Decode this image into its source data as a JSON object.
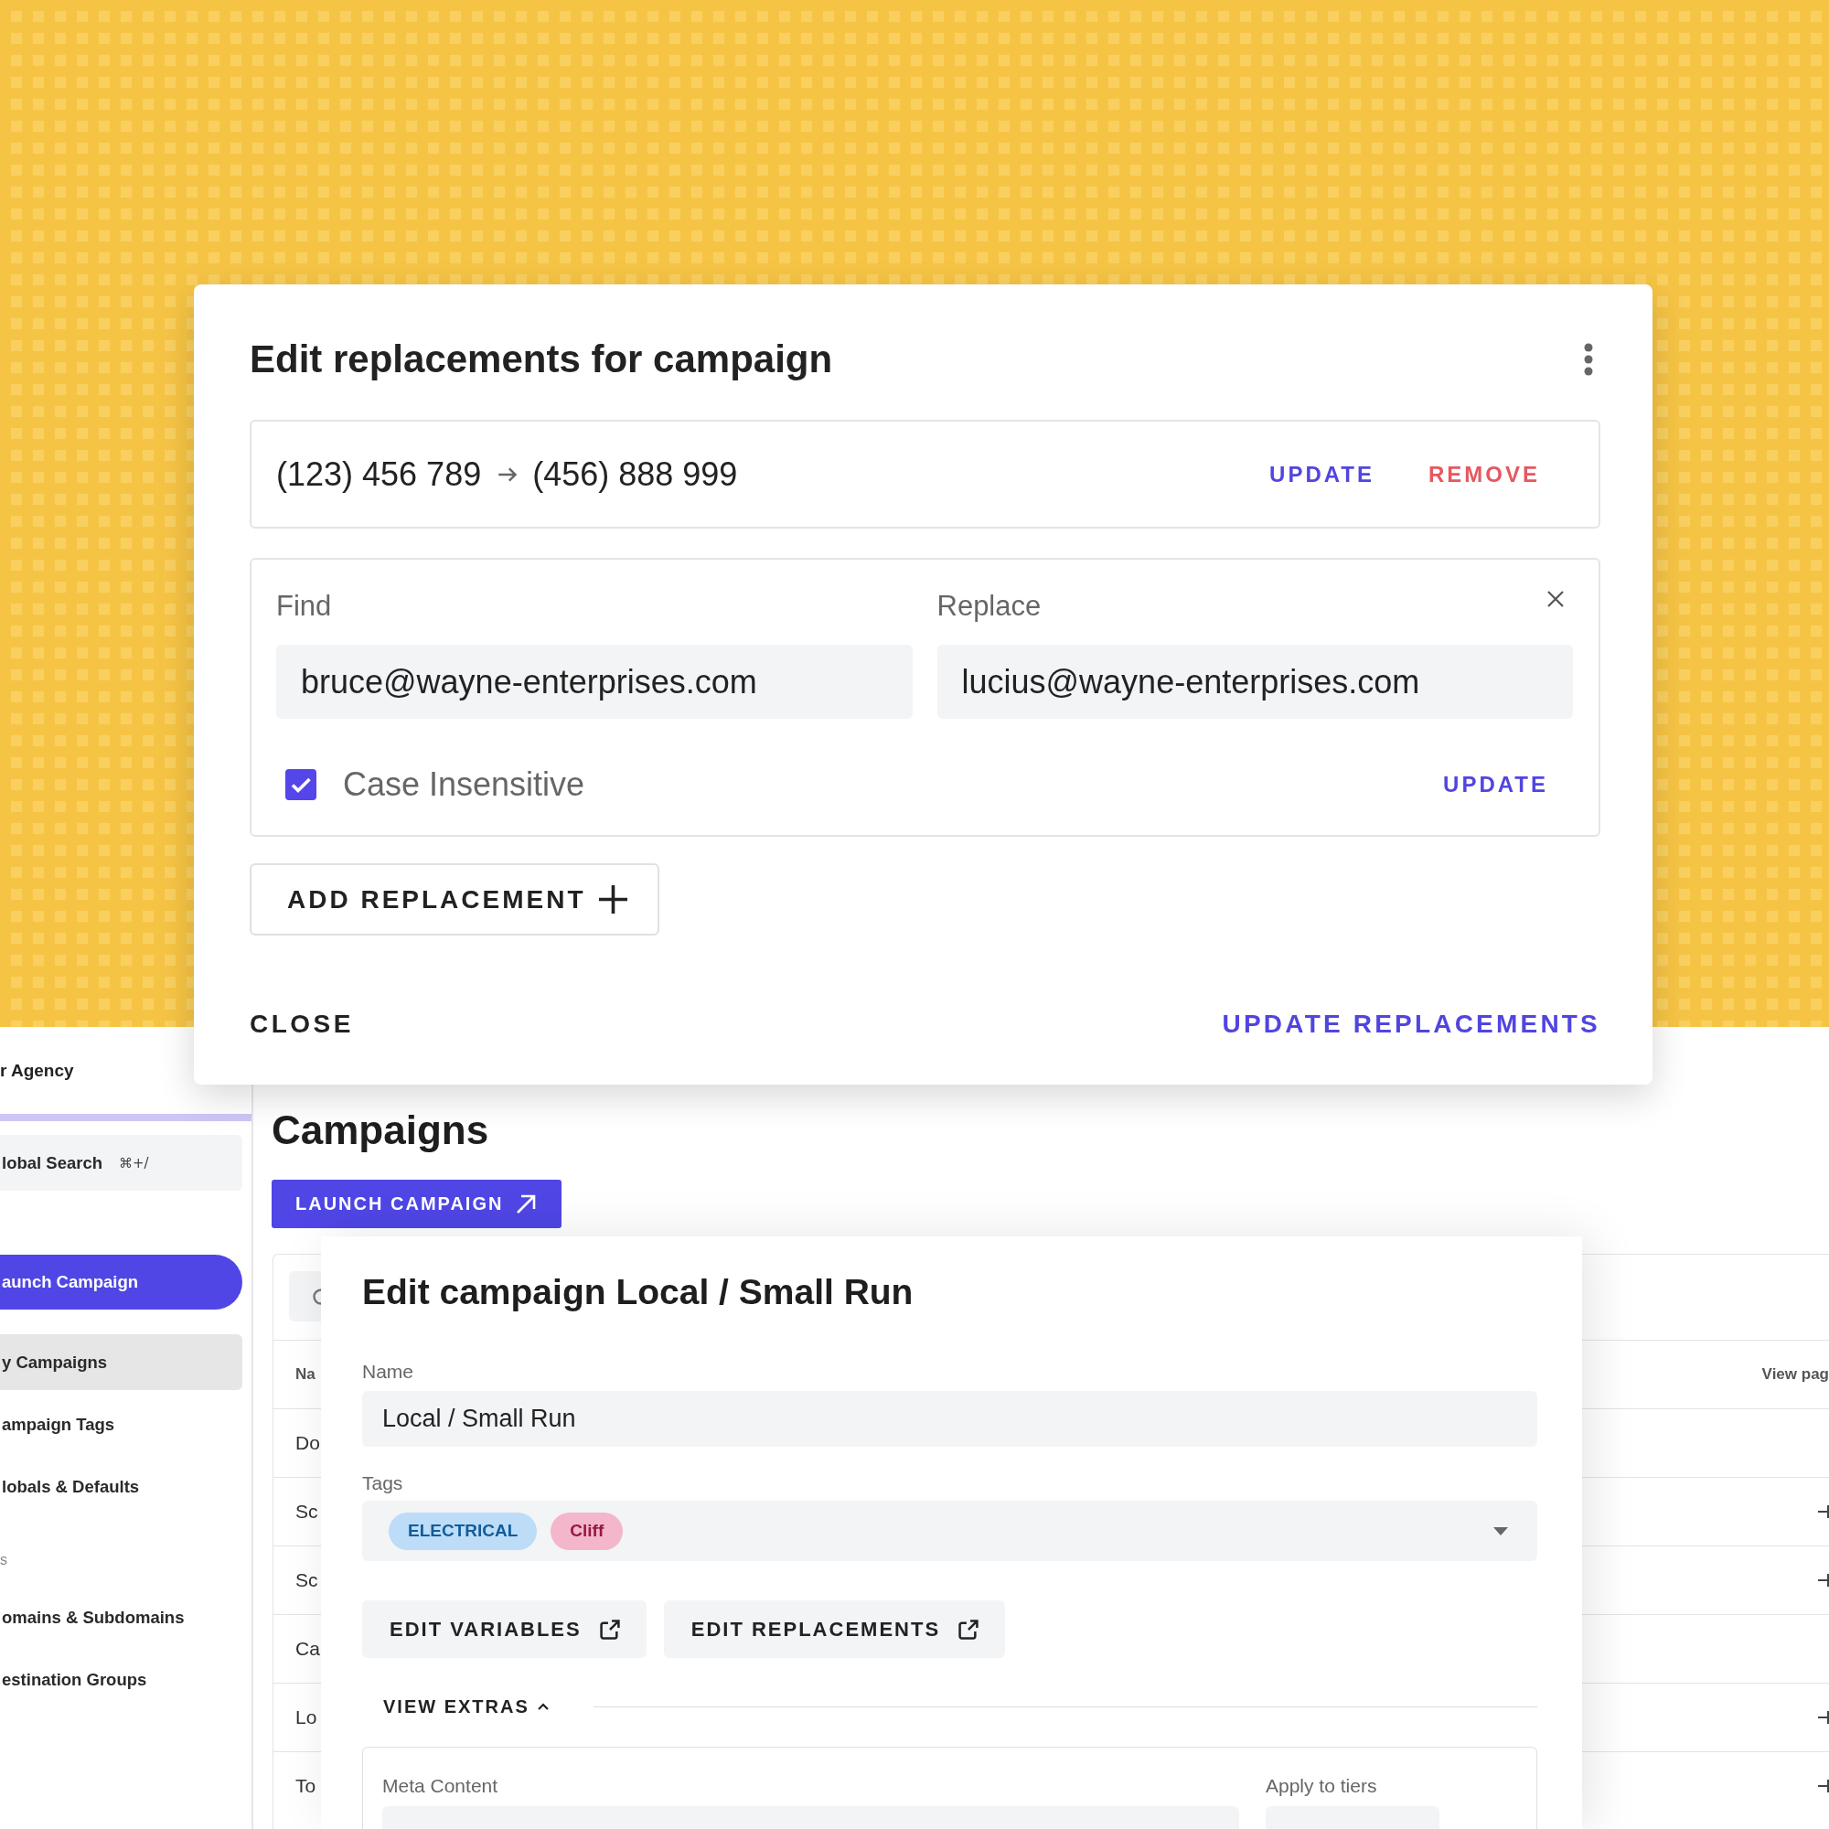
{
  "modal": {
    "title": "Edit replacements for campaign",
    "replacements": [
      {
        "kind": "summary",
        "find": "(123) 456 789",
        "replace": "(456) 888 999",
        "actions": [
          {
            "label": "UPDATE",
            "kind": "update"
          },
          {
            "label": "REMOVE",
            "kind": "remove"
          }
        ]
      },
      {
        "kind": "editor",
        "find_label": "Find",
        "replace_label": "Replace",
        "find": "bruce@wayne-enterprises.com",
        "replace": "lucius@wayne-enterprises.com",
        "option": {
          "label": "Case Insensitive",
          "checked": true
        },
        "action": "UPDATE"
      }
    ],
    "add_button": "ADD REPLACEMENT",
    "close_button": "CLOSE",
    "submit_button": "UPDATE REPLACEMENTS"
  },
  "sidebar": {
    "org": "r Agency",
    "search": {
      "label": "lobal Search",
      "shortcut": "⌘+/"
    },
    "launch_button": "aunch Campaign",
    "groups": [
      {
        "items": [
          {
            "label": "y Campaigns",
            "selected": true
          },
          {
            "label": "ampaign Tags",
            "selected": false
          },
          {
            "label": "lobals & Defaults",
            "selected": false
          }
        ]
      },
      {
        "title": "s",
        "items": [
          {
            "label": "omains & Subdomains",
            "selected": false
          },
          {
            "label": "estination Groups",
            "selected": false
          }
        ]
      }
    ]
  },
  "page": {
    "title": "Campaigns",
    "launch_button": "LAUNCH CAMPAIGN",
    "table": {
      "columns": [
        "Na",
        "View pag"
      ],
      "rows": [
        {
          "cells": [
            "Do"
          ],
          "action_icon": false
        },
        {
          "cells": [
            "Sc"
          ],
          "action_icon": true
        },
        {
          "cells": [
            "Sc"
          ],
          "action_icon": true
        },
        {
          "cells": [
            "Ca"
          ],
          "action_icon": false
        },
        {
          "cells": [
            "Lo"
          ],
          "action_icon": true
        },
        {
          "cells": [
            "To"
          ],
          "action_icon": true
        }
      ]
    }
  },
  "edit_panel": {
    "title": "Edit campaign Local / Small Run",
    "name": {
      "label": "Name",
      "value": "Local / Small Run"
    },
    "tags": {
      "label": "Tags",
      "items": [
        {
          "label": "ELECTRICAL",
          "color": "#bcdcf7"
        },
        {
          "label": "Cliff",
          "color": "#f4b6cb"
        }
      ]
    },
    "buttons": [
      "EDIT VARIABLES",
      "EDIT REPLACEMENTS"
    ],
    "extras": {
      "label": "VIEW EXTRAS",
      "expanded": true,
      "meta_label": "Meta Content",
      "tiers_label": "Apply to tiers"
    }
  }
}
